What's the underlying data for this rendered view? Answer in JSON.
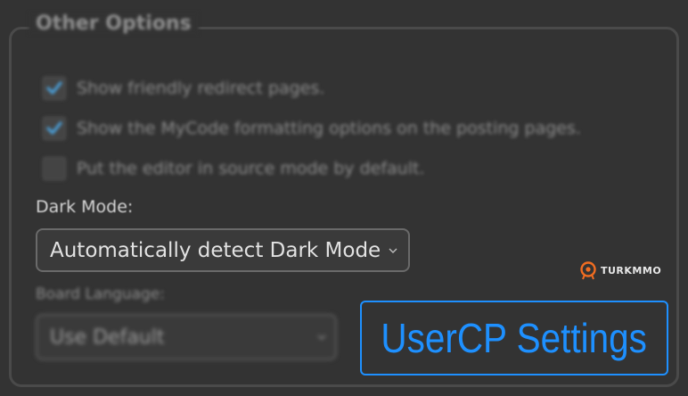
{
  "fieldset": {
    "legend": "Other Options"
  },
  "options": [
    {
      "label": "Show friendly redirect pages.",
      "checked": true
    },
    {
      "label": "Show the MyCode formatting options on the posting pages.",
      "checked": true
    },
    {
      "label": "Put the editor in source mode by default.",
      "checked": false
    }
  ],
  "dark_mode": {
    "label": "Dark Mode:",
    "selected": "Automatically detect Dark Mode"
  },
  "board_language": {
    "label": "Board Language:",
    "selected": "Use Default"
  },
  "watermark": {
    "text": "TURKMMO"
  },
  "overlay": {
    "title": "UserCP Settings"
  },
  "colors": {
    "background": "#333333",
    "accent": "#1e90ff",
    "checkbox_check": "#4aa3df",
    "logo_orange": "#f26d21"
  },
  "icons": [
    "checkmark-icon",
    "chevron-down-icon",
    "turkmmo-logo-icon"
  ]
}
